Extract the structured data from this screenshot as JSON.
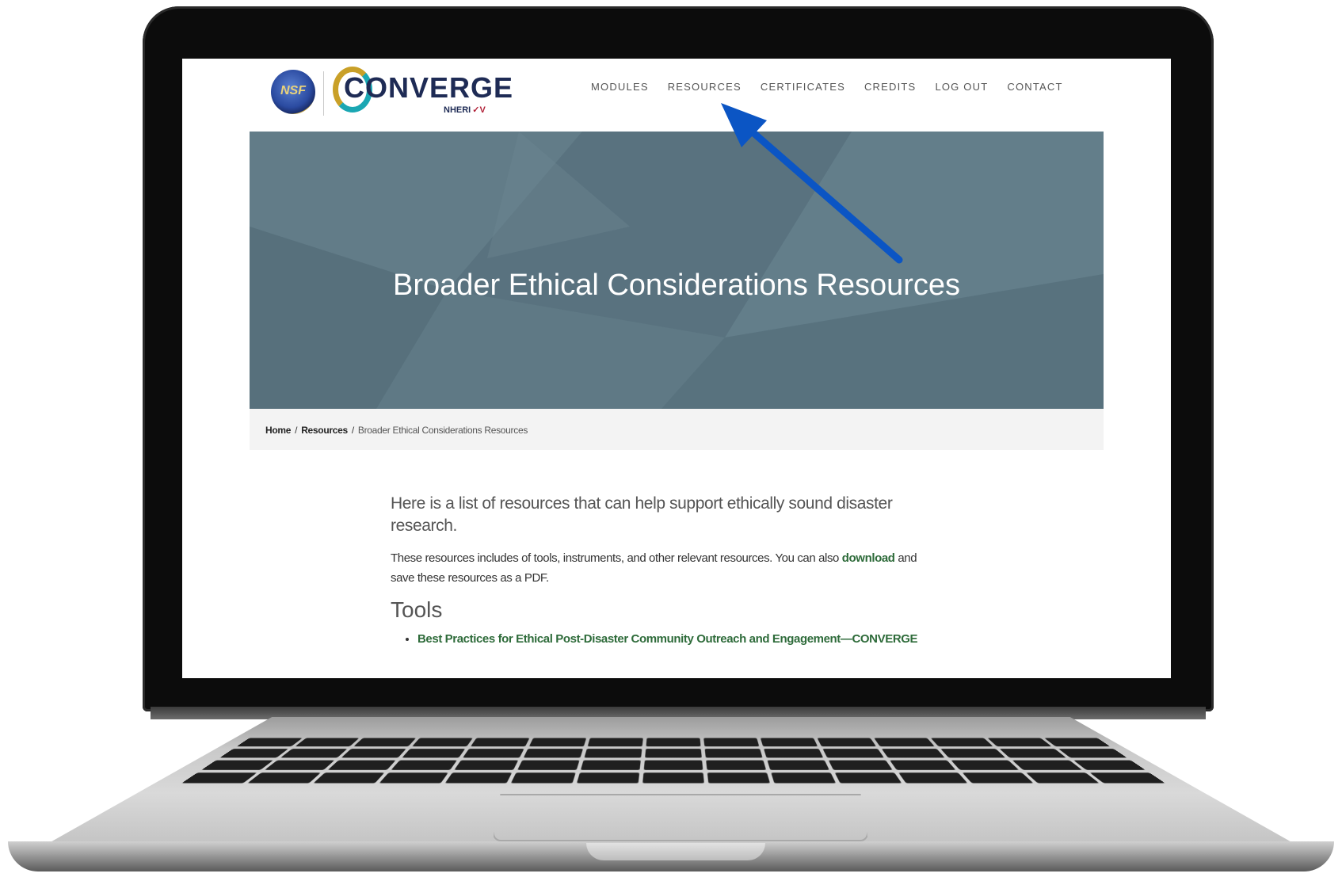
{
  "brand": {
    "seal_text": "NSF",
    "name": "CONVERGE",
    "sub_label": "NHERI",
    "sub_mark": "✓V"
  },
  "nav": {
    "items": [
      {
        "label": "MODULES"
      },
      {
        "label": "RESOURCES"
      },
      {
        "label": "CERTIFICATES"
      },
      {
        "label": "CREDITS"
      },
      {
        "label": "LOG OUT"
      },
      {
        "label": "CONTACT"
      }
    ]
  },
  "hero": {
    "title": "Broader Ethical Considerations Resources"
  },
  "breadcrumb": {
    "home": "Home",
    "resources": "Resources",
    "current": "Broader Ethical Considerations Resources",
    "separator": "/"
  },
  "content": {
    "lead": "Here is a list of resources that can help support ethically sound disaster research.",
    "para_before_link": "These resources includes of tools, instruments, and other relevant resources. You can also ",
    "download_link": "download",
    "para_after_link": " and save these resources as a PDF.",
    "tools_heading": "Tools",
    "tools": [
      "Best Practices for Ethical Post-Disaster Community Outreach and Engagement—CONVERGE"
    ]
  },
  "colors": {
    "hero_bg": "#5c7682",
    "link_green": "#2e6b3a",
    "arrow_blue": "#0b55c4",
    "brand_navy": "#1e2b55"
  }
}
